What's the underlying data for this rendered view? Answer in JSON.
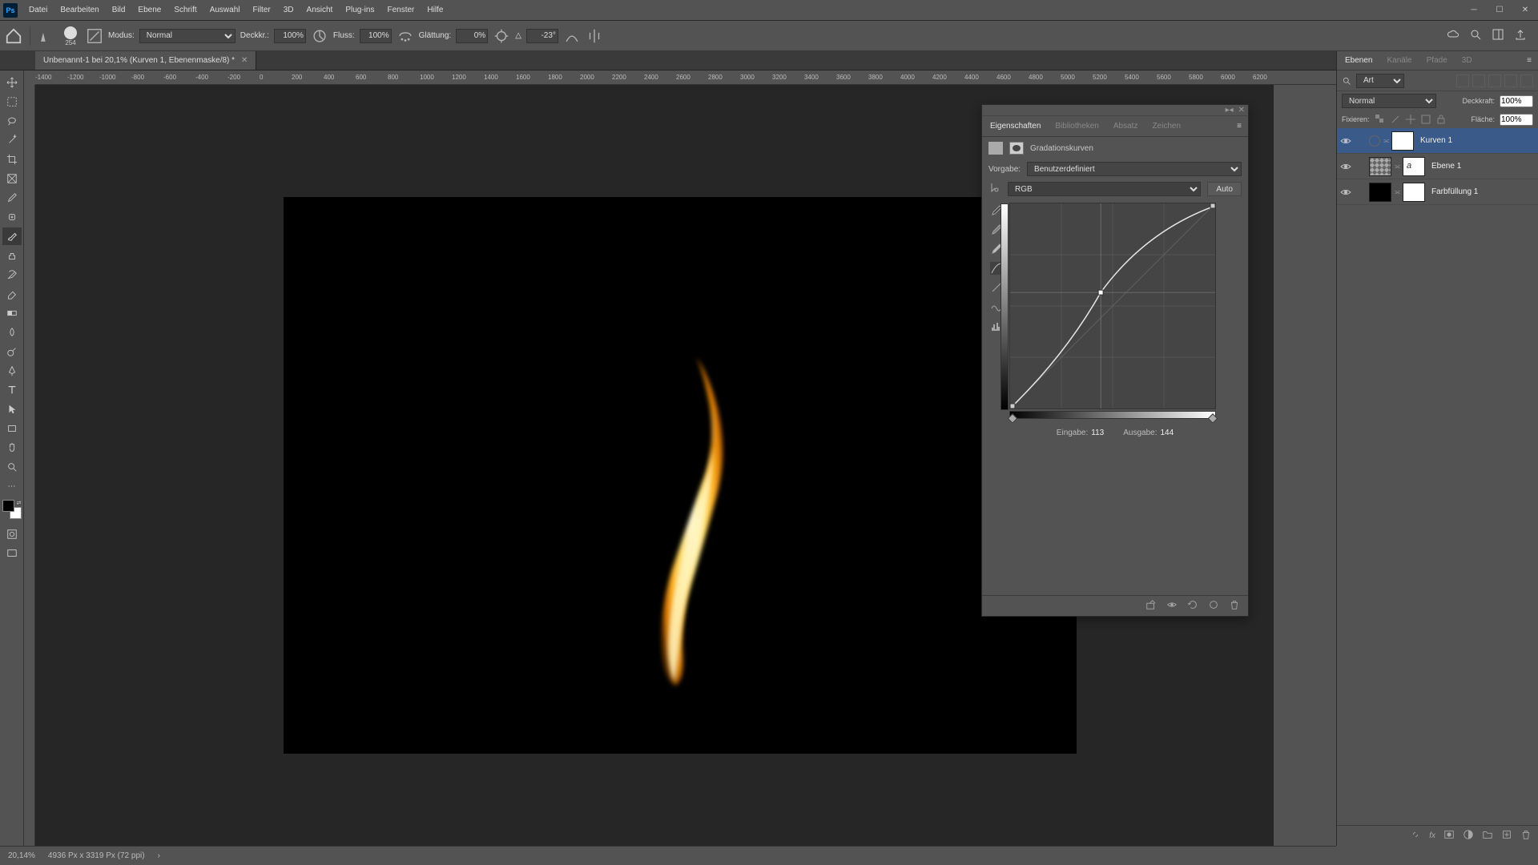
{
  "menu": {
    "items": [
      "Datei",
      "Bearbeiten",
      "Bild",
      "Ebene",
      "Schrift",
      "Auswahl",
      "Filter",
      "3D",
      "Ansicht",
      "Plug-ins",
      "Fenster",
      "Hilfe"
    ]
  },
  "options": {
    "brush_size": "254",
    "mode_label": "Modus:",
    "mode_value": "Normal",
    "opacity_label": "Deckkr.:",
    "opacity_value": "100%",
    "flow_label": "Fluss:",
    "flow_value": "100%",
    "smoothing_label": "Glättung:",
    "smoothing_value": "0%",
    "angle_label": "△",
    "angle_value": "-23°"
  },
  "doc_tab": {
    "title": "Unbenannt-1 bei 20,1% (Kurven 1, Ebenenmaske/8) *"
  },
  "ruler_ticks": [
    "-1400",
    "-1200",
    "-1000",
    "-800",
    "-600",
    "-400",
    "-200",
    "0",
    "200",
    "400",
    "600",
    "800",
    "1000",
    "1200",
    "1400",
    "1600",
    "1800",
    "2000",
    "2200",
    "2400",
    "2600",
    "2800",
    "3000",
    "3200",
    "3400",
    "3600",
    "3800",
    "4000",
    "4200",
    "4400",
    "4600",
    "4800",
    "5000",
    "5200",
    "5400",
    "5600",
    "5800",
    "6000",
    "6200"
  ],
  "props": {
    "tabs": [
      "Eigenschaften",
      "Bibliotheken",
      "Absatz",
      "Zeichen"
    ],
    "adj_name": "Gradationskurven",
    "preset_label": "Vorgabe:",
    "preset_value": "Benutzerdefiniert",
    "channel_value": "RGB",
    "auto_btn": "Auto",
    "input_label": "Eingabe:",
    "input_value": "113",
    "output_label": "Ausgabe:",
    "output_value": "144"
  },
  "layers_panel": {
    "tabs": [
      "Ebenen",
      "Kanäle",
      "Pfade",
      "3D"
    ],
    "filter_label": "Art",
    "blend_mode": "Normal",
    "opacity_label": "Deckkraft:",
    "opacity_value": "100%",
    "fill_label": "Fläche:",
    "fill_value": "100%",
    "lock_label": "Fixieren:",
    "layers": [
      {
        "name": "Kurven 1",
        "type": "adj",
        "active": true
      },
      {
        "name": "Ebene 1",
        "type": "smart",
        "active": false
      },
      {
        "name": "Farbfüllung 1",
        "type": "fill",
        "active": false
      }
    ]
  },
  "status": {
    "zoom": "20,14%",
    "dims": "4936 Px x 3319 Px (72 ppi)"
  }
}
